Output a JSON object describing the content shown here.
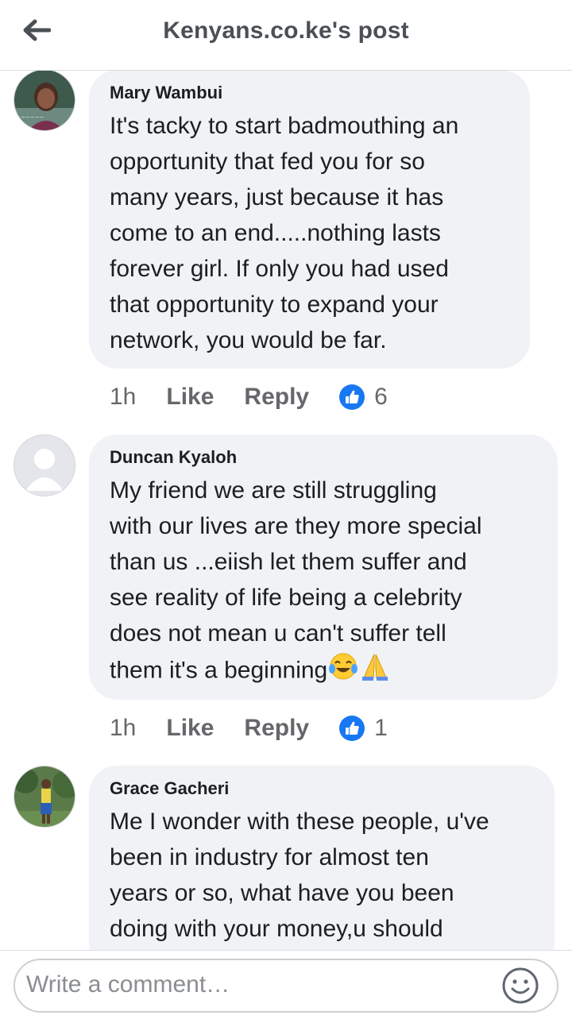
{
  "header": {
    "title": "Kenyans.co.ke's post"
  },
  "comments": [
    {
      "author": "Mary Wambui",
      "text": "It's tacky to start badmouthing an\nopportunity that fed you for so\nmany years, just because it has\ncome to an end.....nothing lasts\nforever girl. If only you had used\nthat opportunity to expand your\nnetwork, you would be far.",
      "time": "1h",
      "like_label": "Like",
      "reply_label": "Reply",
      "reaction_count": "6"
    },
    {
      "author": "Duncan Kyaloh",
      "text": "My friend we are still struggling\nwith our lives are they  more special\nthan us ...eiish let them suffer and\nsee reality of life being a celebrity\ndoes not mean u can't suffer tell\nthem it's a beginning",
      "time": "1h",
      "like_label": "Like",
      "reply_label": "Reply",
      "reaction_count": "1"
    },
    {
      "author": "Grace Gacheri",
      "text": "Me I wonder with these people, u've\nbeen in industry for almost ten\nyears or so, what have you been\ndoing with your money,u should"
    }
  ],
  "composer": {
    "placeholder": "Write a comment…"
  },
  "colors": {
    "like_blue": "#1877f2",
    "bubble_bg": "#f0f2f5",
    "meta_gray": "#65676b"
  }
}
